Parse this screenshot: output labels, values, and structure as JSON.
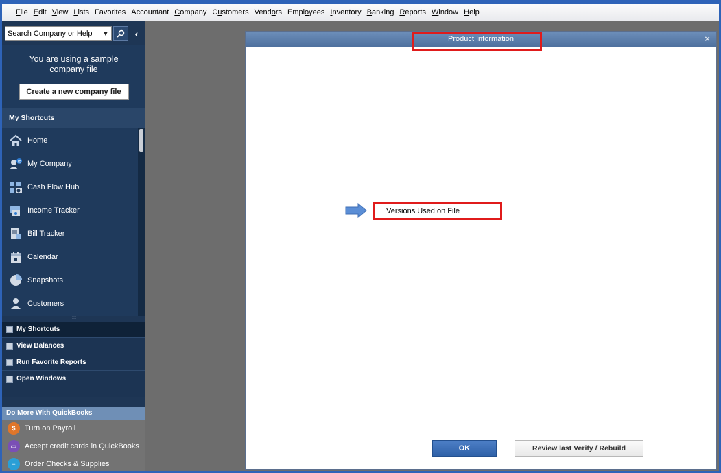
{
  "menubar": {
    "items": [
      {
        "pre": "",
        "ul": "F",
        "post": "ile"
      },
      {
        "pre": "",
        "ul": "E",
        "post": "dit"
      },
      {
        "pre": "",
        "ul": "V",
        "post": "iew"
      },
      {
        "pre": "",
        "ul": "L",
        "post": "ists"
      },
      {
        "pre": "Favorites",
        "ul": "",
        "post": ""
      },
      {
        "pre": "Accountant",
        "ul": "",
        "post": ""
      },
      {
        "pre": "",
        "ul": "C",
        "post": "ompany"
      },
      {
        "pre": "C",
        "ul": "u",
        "post": "stomers"
      },
      {
        "pre": "Vend",
        "ul": "o",
        "post": "rs"
      },
      {
        "pre": "Empl",
        "ul": "o",
        "post": "yees"
      },
      {
        "pre": "",
        "ul": "I",
        "post": "nventory"
      },
      {
        "pre": "",
        "ul": "B",
        "post": "anking"
      },
      {
        "pre": "",
        "ul": "R",
        "post": "eports"
      },
      {
        "pre": "",
        "ul": "W",
        "post": "indow"
      },
      {
        "pre": "",
        "ul": "H",
        "post": "elp"
      }
    ]
  },
  "sidebar": {
    "search_placeholder": "Search Company or Help",
    "sample_text": "You are using a sample company file",
    "create_button": "Create a new company file",
    "shortcuts_header": "My Shortcuts",
    "shortcuts": [
      {
        "label": "Home",
        "icon": "home-icon"
      },
      {
        "label": "My Company",
        "icon": "my-company-icon"
      },
      {
        "label": "Cash Flow Hub",
        "icon": "cash-flow-hub-icon"
      },
      {
        "label": "Income Tracker",
        "icon": "income-tracker-icon"
      },
      {
        "label": "Bill Tracker",
        "icon": "bill-tracker-icon"
      },
      {
        "label": "Calendar",
        "icon": "calendar-icon"
      },
      {
        "label": "Snapshots",
        "icon": "snapshots-icon"
      },
      {
        "label": "Customers",
        "icon": "customers-icon"
      }
    ],
    "nav": [
      {
        "label": "My Shortcuts"
      },
      {
        "label": "View Balances"
      },
      {
        "label": "Run Favorite Reports"
      },
      {
        "label": "Open Windows"
      }
    ],
    "domore_header": "Do More With QuickBooks",
    "domore": [
      {
        "label": "Turn on Payroll",
        "color": "#e0762a"
      },
      {
        "label": "Accept credit cards in QuickBooks",
        "color": "#7a4fb5"
      },
      {
        "label": "Order Checks & Supplies",
        "color": "#2a9fd6"
      }
    ]
  },
  "dialog": {
    "title": "Product Information",
    "close": "×",
    "versions_label": "Versions Used on File",
    "ok_label": "OK",
    "review_label": "Review last Verify / Rebuild"
  },
  "colors": {
    "highlight": "#e01b1b",
    "arrow": "#5b8ed6",
    "sidebar_bg": "#1f3a5c"
  }
}
